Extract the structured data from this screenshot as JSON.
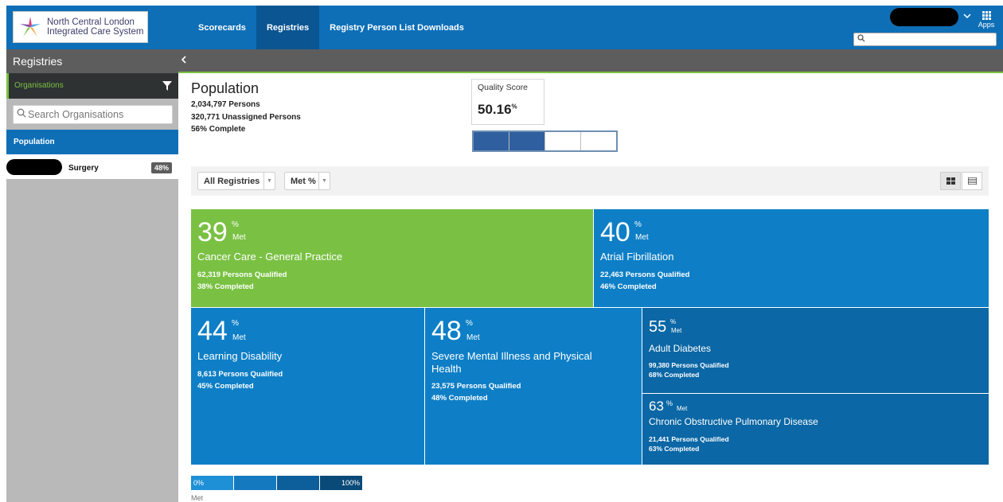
{
  "header": {
    "logo_line1": "North Central London",
    "logo_line2": "Integrated Care System",
    "nav": [
      "Scorecards",
      "Registries",
      "Registry Person List Downloads"
    ],
    "apps_label": "Apps"
  },
  "sidebar": {
    "title": "Registries",
    "organisations_label": "Organisations",
    "search_placeholder": "Search Organisations",
    "population_label": "Population",
    "surgery_name": "Surgery",
    "surgery_badge": "48%"
  },
  "population": {
    "title": "Population",
    "persons": "2,034,797 Persons",
    "unassigned": "320,771 Unassigned Persons",
    "complete": "56% Complete"
  },
  "quality_score": {
    "label": "Quality Score",
    "value": "50.16",
    "unit": "%",
    "filled_segments": 2,
    "total_segments": 4
  },
  "toolbar": {
    "registry_select": "All Registries",
    "metric_select": "Met %"
  },
  "tiles": [
    {
      "value": "39",
      "pct": "%",
      "met": "Met",
      "name": "Cancer Care - General Practice",
      "qualified": "62,319 Persons Qualified",
      "completed": "38% Completed",
      "color": "#7ac143"
    },
    {
      "value": "40",
      "pct": "%",
      "met": "Met",
      "name": "Atrial Fibrillation",
      "qualified": "22,463 Persons Qualified",
      "completed": "46% Completed",
      "color": "#0e7fc6"
    },
    {
      "value": "44",
      "pct": "%",
      "met": "Met",
      "name": "Learning Disability",
      "qualified": "8,613 Persons Qualified",
      "completed": "45% Completed",
      "color": "#0e7fc6"
    },
    {
      "value": "48",
      "pct": "%",
      "met": "Met",
      "name": "Severe Mental Illness and Physical Health",
      "qualified": "23,575 Persons Qualified",
      "completed": "48% Completed",
      "color": "#0e7fc6"
    },
    {
      "value": "55",
      "pct": "%",
      "met": "Met",
      "name": "Adult Diabetes",
      "qualified": "99,380 Persons Qualified",
      "completed": "68% Completed",
      "color": "#0b67a5"
    },
    {
      "value": "63",
      "pct": "%",
      "met": "Met",
      "name": "Chronic Obstructive Pulmonary Disease",
      "qualified": "21,441 Persons Qualified",
      "completed": "63% Completed",
      "color": "#0b67a5"
    }
  ],
  "legend": {
    "min": "0%",
    "max": "100%",
    "caption": "Met",
    "colors": [
      "#1e90d6",
      "#1479bf",
      "#0d5f9c",
      "#0a4a78"
    ]
  }
}
